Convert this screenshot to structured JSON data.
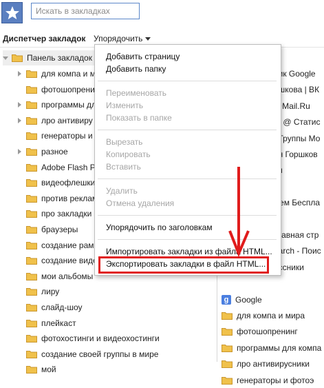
{
  "search": {
    "placeholder": "Искать в закладках"
  },
  "header": {
    "title": "Диспетчер закладок",
    "organize_label": "Упорядочить"
  },
  "tree": {
    "root_label": "Панель закладок",
    "items": [
      {
        "label": "для компа и м",
        "expandable": true
      },
      {
        "label": "фотошопрени",
        "expandable": false
      },
      {
        "label": "программы дл",
        "expandable": true
      },
      {
        "label": "лро антивиру",
        "expandable": true
      },
      {
        "label": "генераторы и",
        "expandable": false
      },
      {
        "label": "разное",
        "expandable": true
      },
      {
        "label": "Adobe Flash Pl",
        "expandable": false
      },
      {
        "label": "видеофлешки",
        "expandable": false
      },
      {
        "label": "против реклам",
        "expandable": false
      },
      {
        "label": "про закладки",
        "expandable": false
      },
      {
        "label": "браузеры",
        "expandable": false
      },
      {
        "label": "создание рам",
        "expandable": false
      },
      {
        "label": "создание виде",
        "expandable": false
      },
      {
        "label": "мои альбомы",
        "expandable": false
      },
      {
        "label": "лиру",
        "expandable": false
      },
      {
        "label": "слайд-шоу",
        "expandable": false
      },
      {
        "label": "плейкаст",
        "expandable": false
      },
      {
        "label": "фотохостинги и видеохостинги",
        "expandable": false
      },
      {
        "label": "создание своей группы в мире",
        "expandable": false
      },
      {
        "label": "мой",
        "expandable": false
      }
    ]
  },
  "right_list": {
    "items": [
      {
        "label": "ник Google",
        "type": "text"
      },
      {
        "label": "ршкова | ВК",
        "type": "text"
      },
      {
        "label": "@Mail.Ru",
        "type": "text"
      },
      {
        "label": "et @ Статис",
        "type": "text"
      },
      {
        "label": "- Группы Мо",
        "type": "text"
      },
      {
        "label": "ия Горшков",
        "type": "text"
      },
      {
        "label": "вя",
        "type": "text"
      },
      {
        "label": "7",
        "type": "text"
      },
      {
        "label": "жем Беспла",
        "type": "text"
      },
      {
        "label": "",
        "type": "text"
      },
      {
        "label": "главная стр",
        "type": "text"
      },
      {
        "label": "earch - Поис",
        "type": "text"
      },
      {
        "label": "ассники",
        "type": "text"
      },
      {
        "label": "",
        "type": "text"
      },
      {
        "label": "Google",
        "type": "google"
      },
      {
        "label": "для компа и мира",
        "type": "folder"
      },
      {
        "label": "фотошопренинг",
        "type": "folder"
      },
      {
        "label": "программы для компа",
        "type": "folder"
      },
      {
        "label": "лро антивирусники",
        "type": "folder"
      },
      {
        "label": "генераторы и фотоэ",
        "type": "folder"
      }
    ]
  },
  "menu": {
    "add_page": "Добавить страницу",
    "add_folder": "Добавить папку",
    "rename": "Переименовать",
    "edit": "Изменить",
    "show_in_folder": "Показать в папке",
    "cut": "Вырезать",
    "copy": "Копировать",
    "paste": "Вставить",
    "delete": "Удалить",
    "undo_delete": "Отмена удаления",
    "sort_by_title": "Упорядочить по заголовкам",
    "import": "Импортировать закладки из файла HTML...",
    "export": "Экспортировать закладки в файл HTML..."
  },
  "colors": {
    "highlight": "#e01c1c",
    "folder": "#e8b84a",
    "star_bg": "#5a7fc0"
  },
  "icons": {
    "star": "star-icon",
    "folder": "folder-icon",
    "google": "google-icon"
  }
}
